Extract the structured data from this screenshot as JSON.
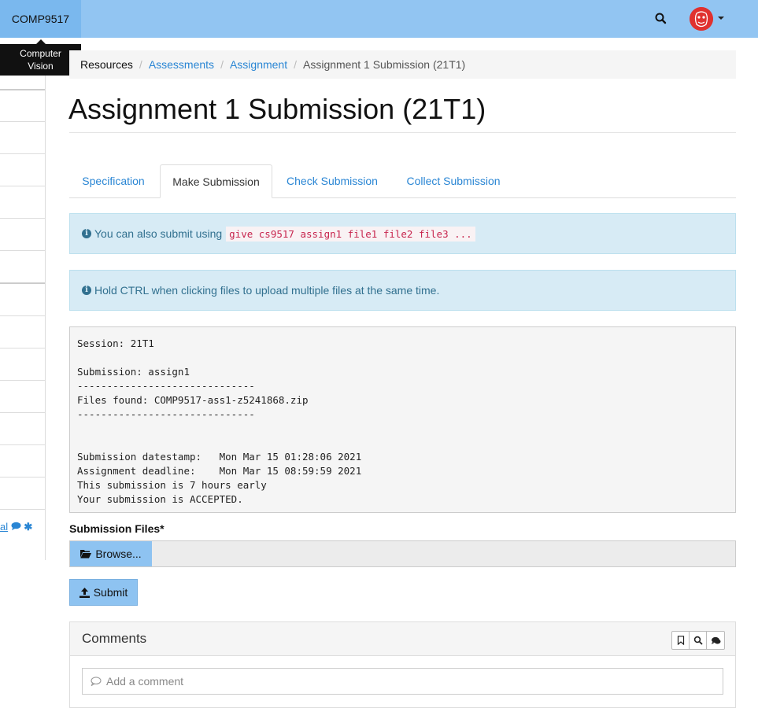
{
  "navbar": {
    "brand": "COMP9517",
    "brand_tooltip_line1": "Computer",
    "brand_tooltip_line2": "Vision"
  },
  "breadcrumb": {
    "items": [
      "Resources",
      "Assessments",
      "Assignment",
      "Assignment 1 Submission (21T1)"
    ]
  },
  "page": {
    "title": "Assignment 1 Submission (21T1)"
  },
  "tabs": [
    {
      "label": "Specification",
      "active": false
    },
    {
      "label": "Make Submission",
      "active": true
    },
    {
      "label": "Check Submission",
      "active": false
    },
    {
      "label": "Collect Submission",
      "active": false
    }
  ],
  "alerts": {
    "give": {
      "text": "You can also submit using",
      "command": "give cs9517 assign1 file1 file2 file3 ..."
    },
    "ctrl": {
      "text": "Hold CTRL when clicking files to upload multiple files at the same time."
    }
  },
  "output_lines": [
    "Session: 21T1",
    "",
    "Submission: assign1",
    "------------------------------",
    "Files found: COMP9517-ass1-z5241868.zip",
    "------------------------------",
    "",
    "",
    "Submission datestamp:   Mon Mar 15 01:28:06 2021",
    "Assignment deadline:    Mon Mar 15 08:59:59 2021",
    "This submission is 7 hours early",
    "Your submission is ACCEPTED."
  ],
  "form": {
    "files_label": "Submission Files*",
    "browse_label": "Browse...",
    "submit_label": "Submit"
  },
  "comments": {
    "title": "Comments",
    "placeholder": "Add a comment"
  },
  "sidebar": {
    "footer_link": "al"
  },
  "colors": {
    "navbar": "#92c5f2",
    "brand": "#7ab8ee",
    "link": "#2a86d4",
    "alert_bg": "#d7ebf5",
    "alert_text": "#31708f",
    "button": "#8ec3f1"
  }
}
